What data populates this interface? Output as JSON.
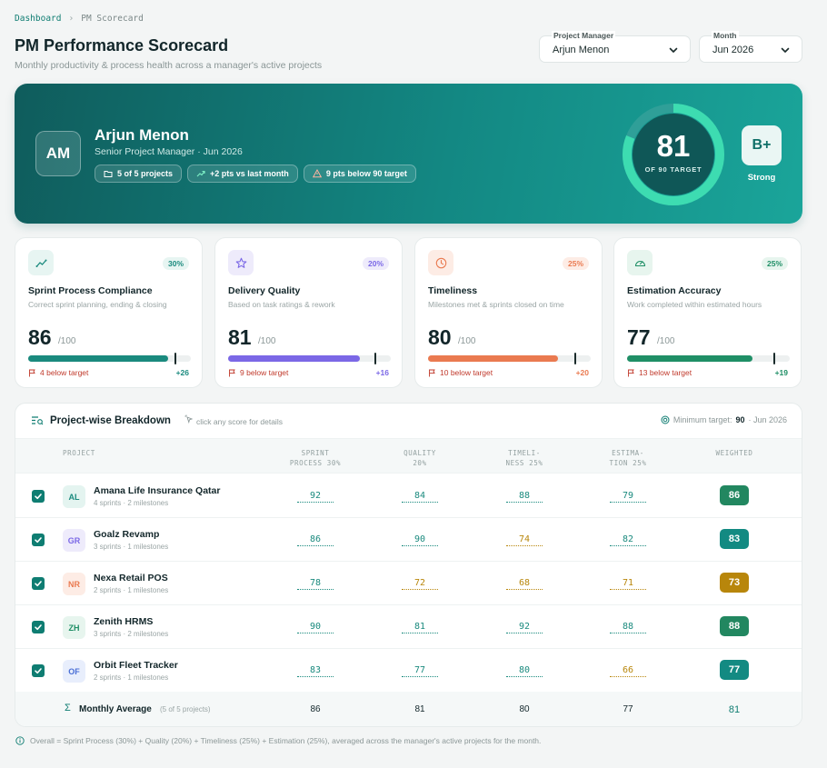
{
  "breadcrumb": {
    "link": "Dashboard",
    "current": "PM Scorecard"
  },
  "page": {
    "title": "PM Performance Scorecard",
    "subtitle": "Monthly productivity & process health across a manager's active projects"
  },
  "filters": {
    "manager_label": "Project Manager",
    "manager_value": "Arjun Menon",
    "month_label": "Month",
    "month_value": "Jun 2026"
  },
  "hero": {
    "initials": "AM",
    "name": "Arjun Menon",
    "role": "Senior Project Manager · Jun 2026",
    "chips": {
      "projects": "5 of 5 projects",
      "trend": "+2 pts  vs last month",
      "gap": "9 pts below 90 target"
    },
    "score": "81",
    "score_sub": "OF 90 TARGET",
    "score_fraction": 0.81,
    "grade": "B+",
    "grade_label": "Strong",
    "colors": {
      "ring": "#3ddcb1",
      "ring_track": "#2f9f98",
      "ring_center": "#0f5757"
    }
  },
  "metrics": [
    {
      "title": "Sprint Process Compliance",
      "desc": "Correct sprint planning, ending & closing",
      "weight": "30%",
      "score": "86",
      "of": "/100",
      "below": "4 below target",
      "delta": "+26",
      "value": 86,
      "target": 90,
      "icon": "trend-up-icon",
      "accent": "#1a8a7e",
      "bg": "#e7f5f2",
      "delta_color": "#1a8a7e"
    },
    {
      "title": "Delivery Quality",
      "desc": "Based on task ratings & rework",
      "weight": "20%",
      "score": "81",
      "of": "/100",
      "below": "9 below target",
      "delta": "+16",
      "value": 81,
      "target": 90,
      "icon": "star-icon",
      "accent": "#7b68e6",
      "bg": "#eeebfb",
      "delta_color": "#7b68e6"
    },
    {
      "title": "Timeliness",
      "desc": "Milestones met & sprints closed on time",
      "weight": "25%",
      "score": "80",
      "of": "/100",
      "below": "10 below target",
      "delta": "+20",
      "value": 80,
      "target": 90,
      "icon": "clock-icon",
      "accent": "#ea7a50",
      "bg": "#fdece5",
      "delta_color": "#ea7a50"
    },
    {
      "title": "Estimation Accuracy",
      "desc": "Work completed within estimated hours",
      "weight": "25%",
      "score": "77",
      "of": "/100",
      "below": "13 below target",
      "delta": "+19",
      "value": 77,
      "target": 90,
      "icon": "gauge-icon",
      "accent": "#1f8f66",
      "bg": "#e7f5ee",
      "delta_color": "#1f8f66"
    }
  ],
  "breakdown": {
    "title": "Project-wise Breakdown",
    "hint": "click any score for details",
    "target_label": "Minimum target:",
    "target_value": "90",
    "month": "· Jun 2026",
    "headers": {
      "project": "PROJECT",
      "sprint_l1": "SPRINT",
      "sprint_l2": "PROCESS 30%",
      "quality_l1": "QUALITY",
      "quality_l2": "20%",
      "time_l1": "TIMELI-",
      "time_l2": "NESS 25%",
      "est_l1": "ESTIMA-",
      "est_l2": "TION 25%",
      "weighted": "WEIGHTED"
    },
    "rows": [
      {
        "initials": "AL",
        "name": "Amana Life Insurance Qatar",
        "meta": "4 sprints · 2 milestones",
        "sprint": "92",
        "quality": "84",
        "time": "88",
        "est": "79",
        "weighted": "86",
        "av_bg": "#e4f4f0",
        "av_fg": "#1a8a7e",
        "c_sprint": "#1a8a7e",
        "c_quality": "#1a8a7e",
        "c_time": "#1a8a7e",
        "c_est": "#1a8a7e",
        "w_bg": "#228760"
      },
      {
        "initials": "GR",
        "name": "Goalz Revamp",
        "meta": "3 sprints · 1 milestones",
        "sprint": "86",
        "quality": "90",
        "time": "74",
        "est": "82",
        "weighted": "83",
        "av_bg": "#eeebfb",
        "av_fg": "#7b68e6",
        "c_sprint": "#1a8a7e",
        "c_quality": "#1a8a7e",
        "c_time": "#b8860b",
        "c_est": "#1a8a7e",
        "w_bg": "#138a82"
      },
      {
        "initials": "NR",
        "name": "Nexa Retail POS",
        "meta": "2 sprints · 1 milestones",
        "sprint": "78",
        "quality": "72",
        "time": "68",
        "est": "71",
        "weighted": "73",
        "av_bg": "#fdece5",
        "av_fg": "#ea7a50",
        "c_sprint": "#1a8a7e",
        "c_quality": "#b8860b",
        "c_time": "#b8860b",
        "c_est": "#b8860b",
        "w_bg": "#b8860b"
      },
      {
        "initials": "ZH",
        "name": "Zenith HRMS",
        "meta": "3 sprints · 2 milestones",
        "sprint": "90",
        "quality": "81",
        "time": "92",
        "est": "88",
        "weighted": "88",
        "av_bg": "#e7f5ee",
        "av_fg": "#1f8f66",
        "c_sprint": "#1a8a7e",
        "c_quality": "#1a8a7e",
        "c_time": "#1a8a7e",
        "c_est": "#1a8a7e",
        "w_bg": "#228760"
      },
      {
        "initials": "OF",
        "name": "Orbit Fleet Tracker",
        "meta": "2 sprints · 1 milestones",
        "sprint": "83",
        "quality": "77",
        "time": "80",
        "est": "66",
        "weighted": "77",
        "av_bg": "#e8eefc",
        "av_fg": "#4a6fd6",
        "c_sprint": "#1a8a7e",
        "c_quality": "#1a8a7e",
        "c_time": "#1a8a7e",
        "c_est": "#b8860b",
        "w_bg": "#138a82"
      }
    ],
    "average": {
      "sigma": "Σ",
      "label": "Monthly Average",
      "note": "(5 of 5 projects)",
      "sprint": "86",
      "quality": "81",
      "time": "80",
      "est": "77",
      "weighted": "81"
    }
  },
  "footer": "Overall = Sprint Process (30%) + Quality (20%) + Timeliness (25%) + Estimation (25%), averaged across the manager's active projects for the month."
}
